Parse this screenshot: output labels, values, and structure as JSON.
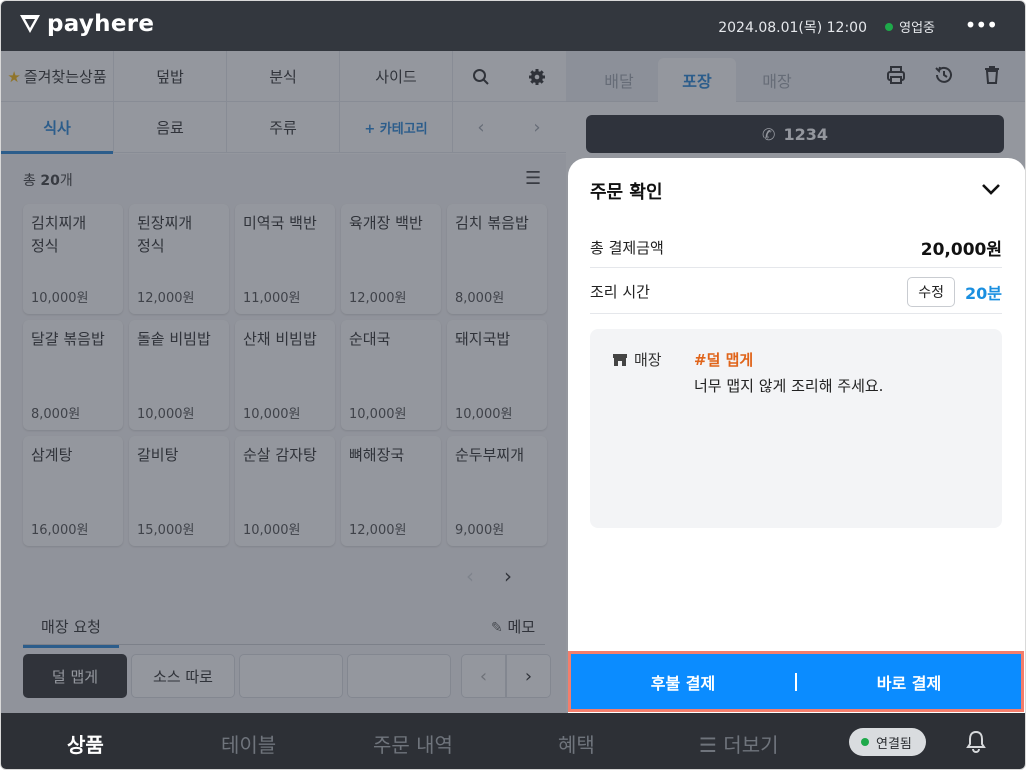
{
  "header": {
    "brand": "payhere",
    "datetime": "2024.08.01(목) 12:00",
    "status": "영업중",
    "more_icon": "more-horizontal-icon"
  },
  "categories": {
    "row1": [
      "즐겨찾는상품",
      "덮밥",
      "분식",
      "사이드"
    ],
    "row2": [
      "식사",
      "음료",
      "주류",
      "+ 카테고리"
    ],
    "active": "식사"
  },
  "menu": {
    "total_prefix": "총 ",
    "total_count": "20",
    "total_suffix": "개",
    "items": [
      {
        "name": "김치찌개 정식",
        "price": "10,000원"
      },
      {
        "name": "된장찌개 정식",
        "price": "12,000원"
      },
      {
        "name": "미역국 백반",
        "price": "11,000원"
      },
      {
        "name": "육개장 백반",
        "price": "12,000원"
      },
      {
        "name": "김치 볶음밥",
        "price": "8,000원"
      },
      {
        "name": "달걀 볶음밥",
        "price": "8,000원"
      },
      {
        "name": "돌솥 비빔밥",
        "price": "10,000원"
      },
      {
        "name": "산채 비빔밥",
        "price": "10,000원"
      },
      {
        "name": "순대국",
        "price": "10,000원"
      },
      {
        "name": "돼지국밥",
        "price": "10,000원"
      },
      {
        "name": "삼계탕",
        "price": "16,000원"
      },
      {
        "name": "갈비탕",
        "price": "15,000원"
      },
      {
        "name": "순살 감자탕",
        "price": "10,000원"
      },
      {
        "name": "뼈해장국",
        "price": "12,000원"
      },
      {
        "name": "순두부찌개",
        "price": "9,000원"
      }
    ]
  },
  "requests": {
    "tab": "매장 요청",
    "memo": "메모",
    "items": [
      "덜 맵게",
      "소스 따로",
      "",
      ""
    ]
  },
  "order": {
    "tabs": [
      "배달",
      "포장",
      "매장"
    ],
    "active_tab": "포장",
    "phone": "1234"
  },
  "confirm": {
    "title": "주문 확인",
    "total_label": "총 결제금액",
    "total_value": "20,000원",
    "time_label": "조리 시간",
    "edit_label": "수정",
    "time_value": "20분",
    "store_label": "매장",
    "memo_tag": "#덜 맵게",
    "memo_text": "너무 맵지 않게 조리해 주세요.",
    "pay_later": "후불 결제",
    "pay_now": "바로 결제"
  },
  "bottom_nav": {
    "items": [
      "상품",
      "테이블",
      "주문 내역",
      "혜택",
      "더보기"
    ],
    "active": "상품",
    "connection": "연결됨"
  },
  "colors": {
    "accent": "#1a7fd6",
    "pay": "#0b8cff",
    "highlight_border": "#f47e6c",
    "tag": "#e0641a"
  }
}
